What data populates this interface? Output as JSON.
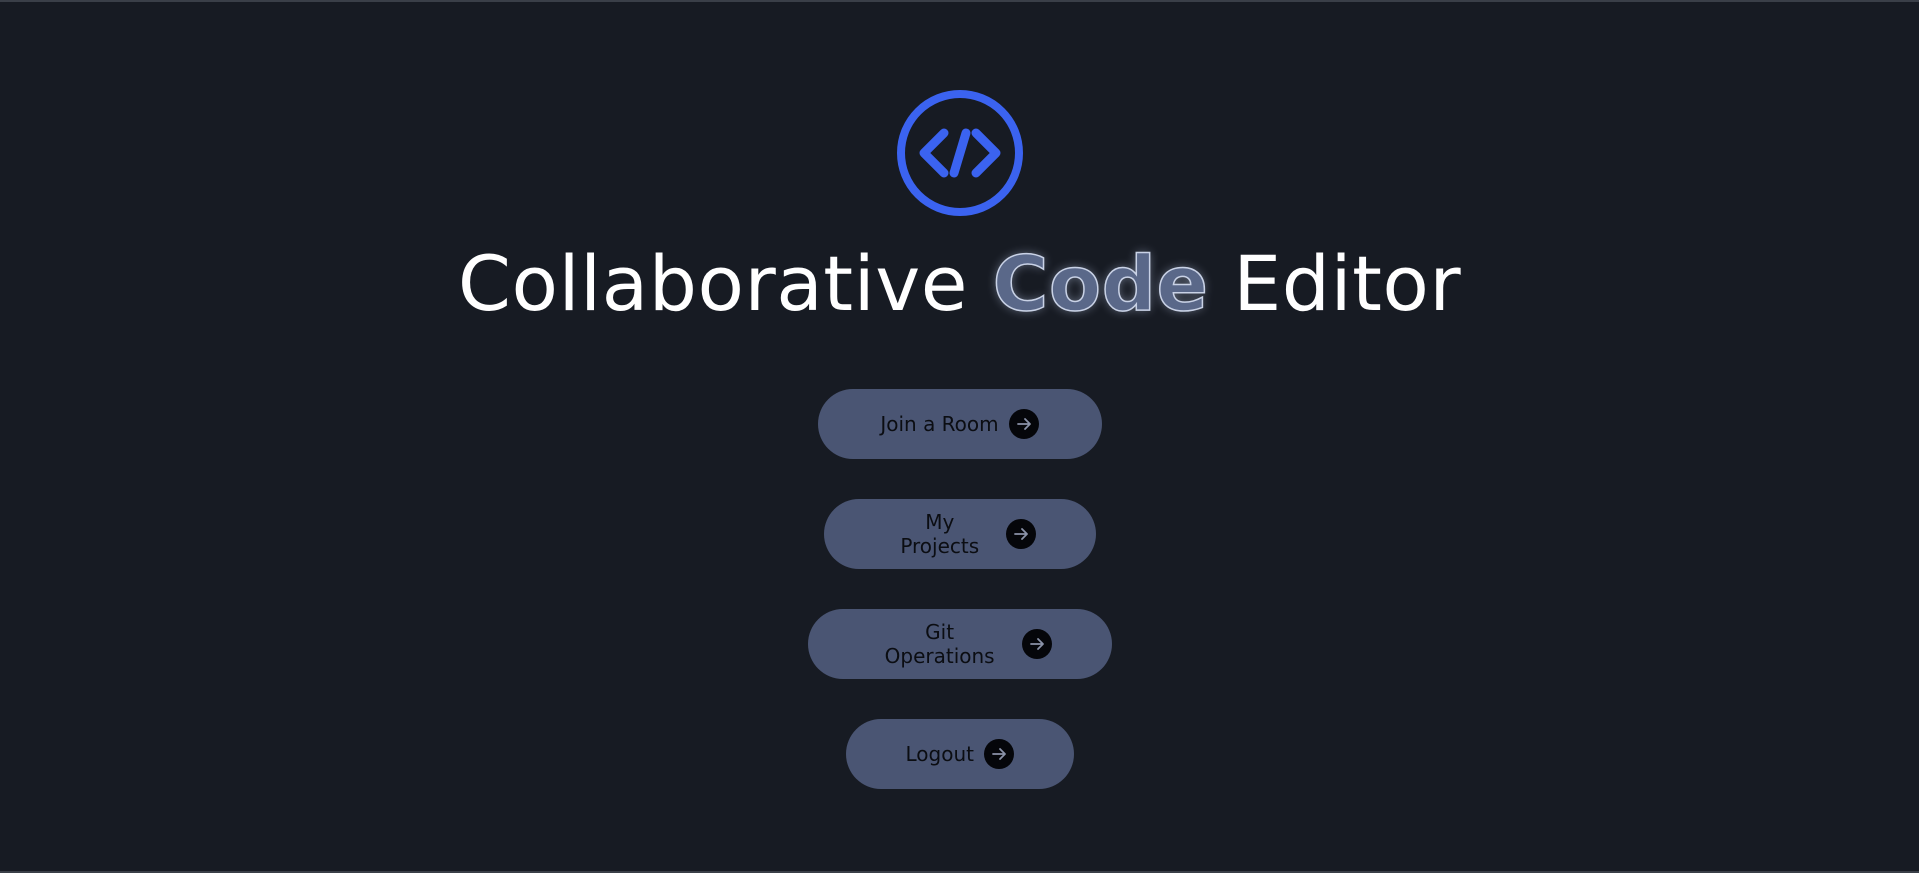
{
  "header": {
    "logo_icon": "code-brackets-circle-icon",
    "title_prefix": "Collaborative ",
    "title_highlight": "Code",
    "title_suffix": " Editor"
  },
  "menu": {
    "join_room_label": "Join a Room",
    "my_projects_label": "My Projects",
    "git_operations_label": "Git Operations",
    "logout_label": "Logout",
    "button_icon": "arrow-right-icon"
  },
  "colors": {
    "background": "#171b23",
    "accent": "#3b63f0",
    "button": "#4a5573",
    "title": "#ffffff"
  }
}
